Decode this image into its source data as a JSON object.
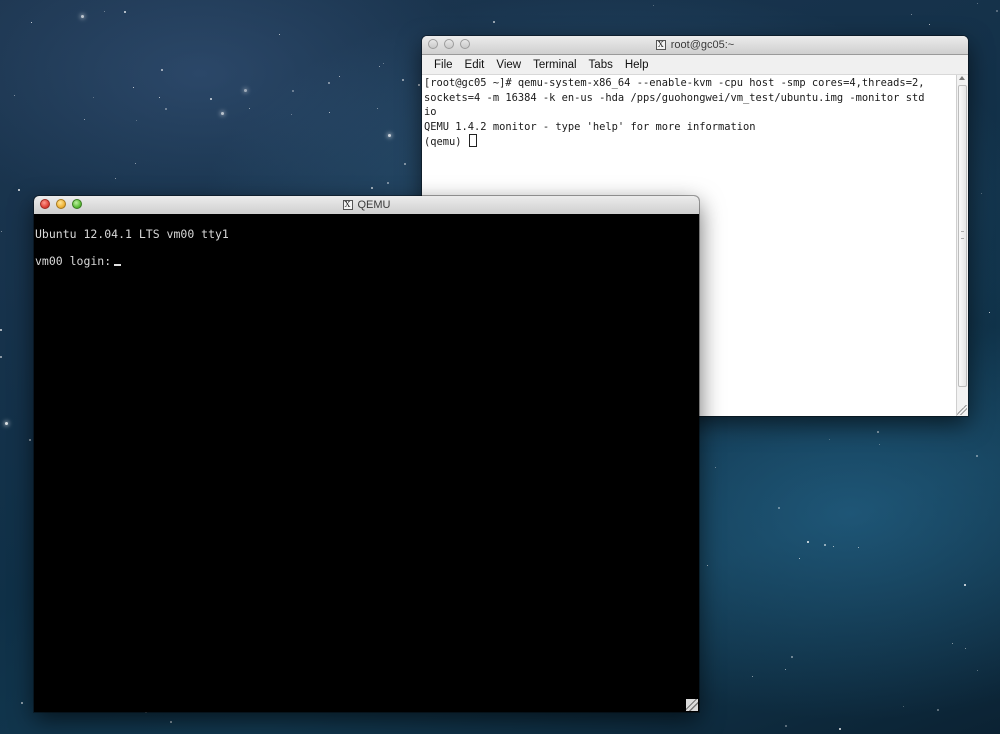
{
  "terminal_window": {
    "title": "root@gc05:~",
    "title_icon": "x11-icon",
    "menu": [
      "File",
      "Edit",
      "View",
      "Terminal",
      "Tabs",
      "Help"
    ],
    "lines": [
      "[root@gc05 ~]# qemu-system-x86_64 --enable-kvm -cpu host -smp cores=4,threads=2,",
      "sockets=4 -m 16384 -k en-us -hda /pps/guohongwei/vm_test/ubuntu.img -monitor std",
      "io",
      "QEMU 1.4.2 monitor - type 'help' for more information"
    ],
    "prompt": "(qemu) "
  },
  "qemu_window": {
    "title": "QEMU",
    "title_icon": "x11-icon",
    "console_line1": "Ubuntu 12.04.1 LTS vm00 tty1",
    "login_prompt": "vm00 login:"
  },
  "colors": {
    "console_background": "#000000",
    "console_text": "#d8d8d8",
    "terminal_background": "#ffffff"
  }
}
